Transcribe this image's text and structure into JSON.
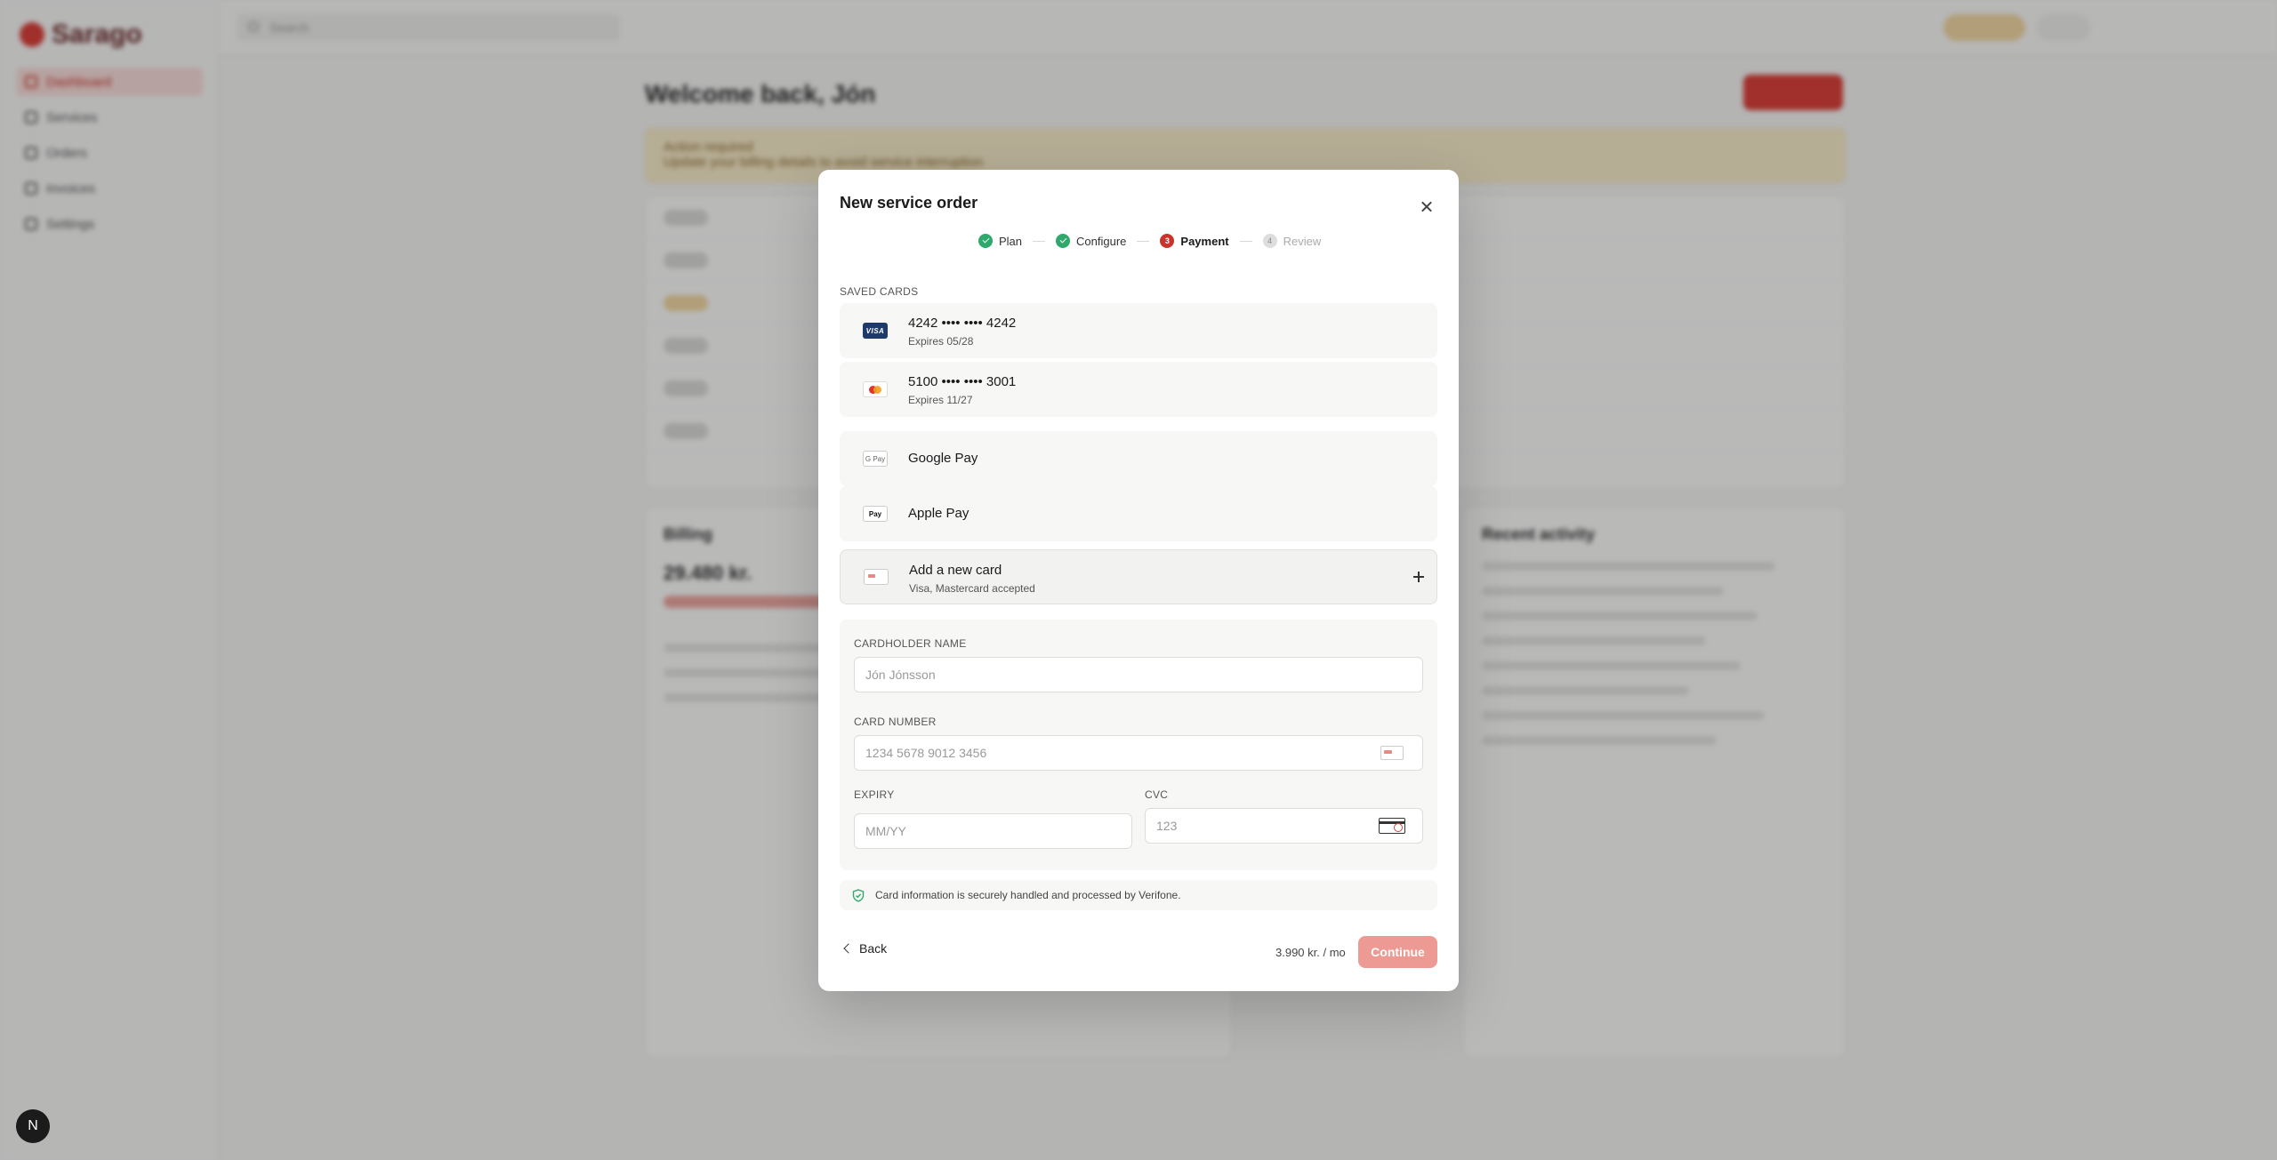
{
  "background": {
    "brand": "Sarago",
    "nav_items": [
      "Dashboard",
      "Services",
      "Orders",
      "Invoices",
      "Settings"
    ],
    "search_placeholder": "Search",
    "welcome": "Welcome back, Jón",
    "alert_title": "Action required",
    "alert_text": "Update your billing details to avoid service interruption",
    "billing_title": "Billing",
    "billing_amount": "29.480 kr.",
    "activity_title": "Recent activity"
  },
  "modal": {
    "title": "New service order",
    "steps": [
      {
        "label": "Plan",
        "state": "done",
        "marker": ""
      },
      {
        "label": "Configure",
        "state": "done",
        "marker": ""
      },
      {
        "label": "Payment",
        "state": "current",
        "marker": "3"
      },
      {
        "label": "Review",
        "state": "todo",
        "marker": "4"
      }
    ],
    "saved_cards_label": "SAVED CARDS",
    "cards": [
      {
        "logo": "VISA",
        "number": "4242 •••• •••• 4242",
        "expiry": "Expires 05/28"
      },
      {
        "logo": "mastercard-icon",
        "number": "5100 •••• •••• 3001",
        "expiry": "Expires 11/27"
      }
    ],
    "wallets": [
      {
        "logo": "G Pay",
        "label": "Google Pay"
      },
      {
        "logo": "Pay",
        "label": "Apple Pay"
      }
    ],
    "add_card": {
      "title": "Add a new card",
      "subtitle": "Visa, Mastercard accepted"
    },
    "form": {
      "cardholder_label": "CARDHOLDER NAME",
      "cardholder_placeholder": "Jón Jónsson",
      "card_number_label": "CARD NUMBER",
      "card_number_placeholder": "1234 5678 9012 3456",
      "expiry_label": "EXPIRY",
      "expiry_placeholder": "MM/YY",
      "cvc_label": "CVC",
      "cvc_placeholder": "123"
    },
    "secure_note": "Card information is securely handled and processed by Verifone.",
    "back_label": "Back",
    "price": "3.990 kr. / mo",
    "continue_label": "Continue"
  },
  "colors": {
    "accent": "#c8342d",
    "continue_disabled": "#ee9a94",
    "success": "#2ea86b"
  },
  "dev_badge": "N"
}
